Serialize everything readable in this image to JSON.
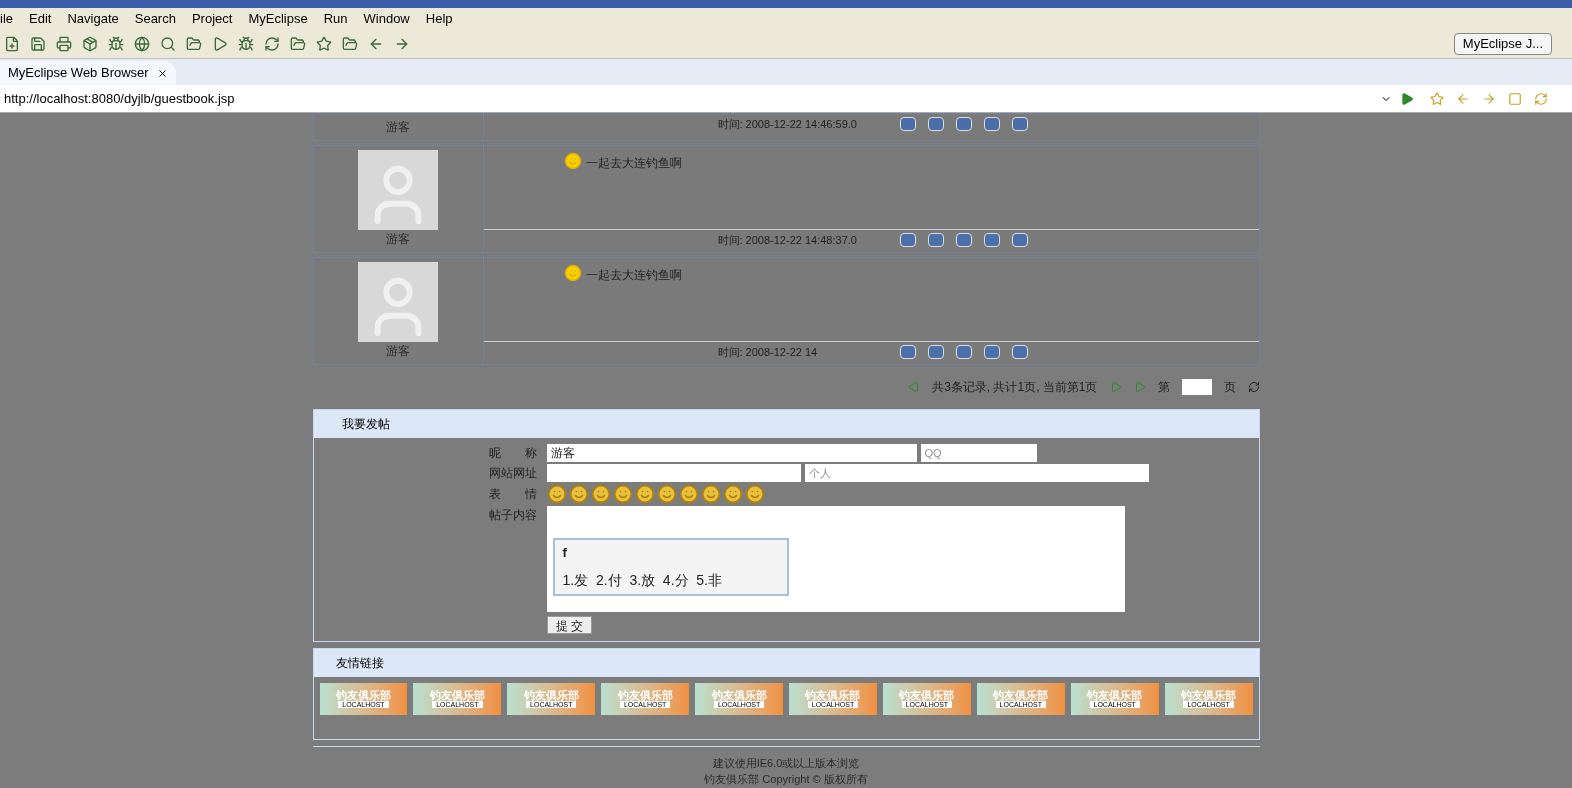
{
  "menu": [
    "ile",
    "Edit",
    "Navigate",
    "Search",
    "Project",
    "MyEclipse",
    "Run",
    "Window",
    "Help"
  ],
  "perspective": "MyEclipse J...",
  "editor_tab": {
    "label": "MyEclipse Web Browser",
    "selected": true
  },
  "address": "http://localhost:8080/dyjlb/guestbook.jsp",
  "posts": [
    {
      "name": "游客",
      "time": "时间: 2008-12-22 14:46:59.0",
      "partial": true
    },
    {
      "name": "游客",
      "message": "一起去大连钓鱼啊",
      "time": "时间: 2008-12-22 14:48:37.0",
      "partial": false
    },
    {
      "name": "游客",
      "message": "一起去大连钓鱼啊",
      "time": "时间: 2008-12-22 14",
      "partial": false
    }
  ],
  "pager": {
    "summary": "共3条记录, 共计1页, 当前第1页",
    "page_prefix": "第",
    "page_suffix": "页"
  },
  "post_form": {
    "title": "我要发帖",
    "nickname_label": "昵　　称",
    "nickname": "游客",
    "qq_placeholder": "QQ",
    "website_label": "网站网址",
    "homepage_placeholder": "个人",
    "emotion_label": "表　　情",
    "content_label": "帖子内容",
    "ime": {
      "input": "f",
      "candidates": "1.发  2.付  3.放  4.分  5.非"
    },
    "submit": "提 交"
  },
  "links": {
    "title": "友情链接",
    "banners": [
      {
        "title": "钓友俱乐部",
        "sub": "LOCALHOST"
      },
      {
        "title": "钓友俱乐部",
        "sub": "LOCALHOST"
      },
      {
        "title": "钓友俱乐部",
        "sub": "LOCALHOST"
      },
      {
        "title": "钓友俱乐部",
        "sub": "LOCALHOST"
      },
      {
        "title": "钓友俱乐部",
        "sub": "LOCALHOST"
      },
      {
        "title": "钓友俱乐部",
        "sub": "LOCALHOST"
      },
      {
        "title": "钓友俱乐部",
        "sub": "LOCALHOST"
      },
      {
        "title": "钓友俱乐部",
        "sub": "LOCALHOST"
      },
      {
        "title": "钓友俱乐部",
        "sub": "LOCALHOST"
      },
      {
        "title": "钓友俱乐部",
        "sub": "LOCALHOST"
      }
    ]
  },
  "footer": [
    "建议使用IE6.0或以上版本浏览",
    "钓友俱乐部 Copyright © 版权所有"
  ]
}
